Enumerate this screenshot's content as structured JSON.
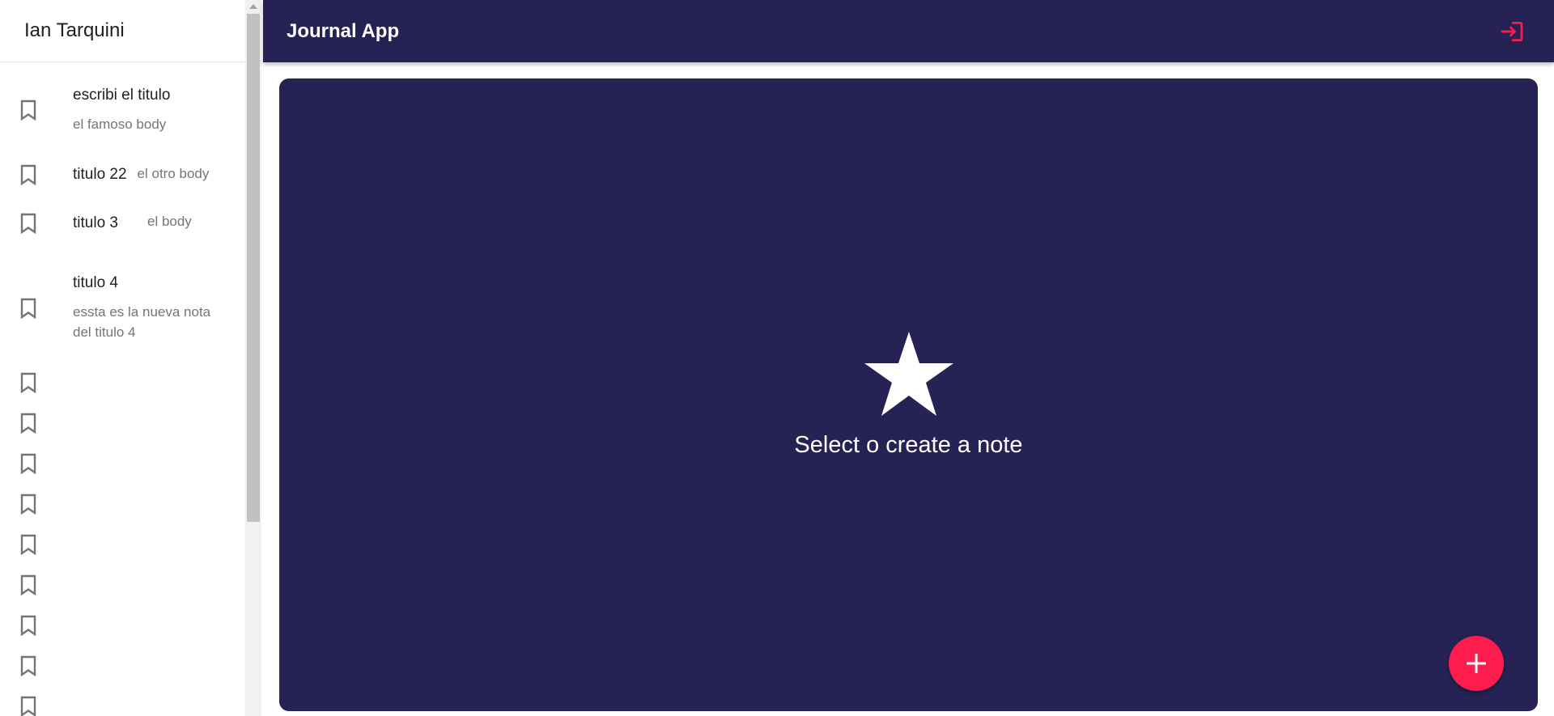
{
  "sidebar": {
    "user_name": "Ian Tarquini",
    "notes": [
      {
        "title": "escribi el titulo",
        "body": "el famoso body"
      },
      {
        "title": "titulo 22",
        "body": "el otro body"
      },
      {
        "title": "titulo 3",
        "body": "el body"
      },
      {
        "title": "titulo 4",
        "body": "essta es la nueva nota del titulo 4"
      },
      {
        "title": "",
        "body": ""
      },
      {
        "title": "",
        "body": ""
      },
      {
        "title": "",
        "body": ""
      },
      {
        "title": "",
        "body": ""
      },
      {
        "title": "",
        "body": ""
      },
      {
        "title": "",
        "body": ""
      },
      {
        "title": "",
        "body": ""
      },
      {
        "title": "",
        "body": ""
      },
      {
        "title": "",
        "body": ""
      }
    ],
    "note_icon": "bookmark-border-icon"
  },
  "appbar": {
    "title": "Journal App",
    "logout_icon": "login-icon"
  },
  "main": {
    "empty_icon": "star-icon",
    "empty_message": "Select o create a note",
    "fab_icon": "add-icon"
  },
  "colors": {
    "primary": "#262254",
    "accent": "#fe1d4e",
    "sidebar_bg": "#ffffff"
  }
}
